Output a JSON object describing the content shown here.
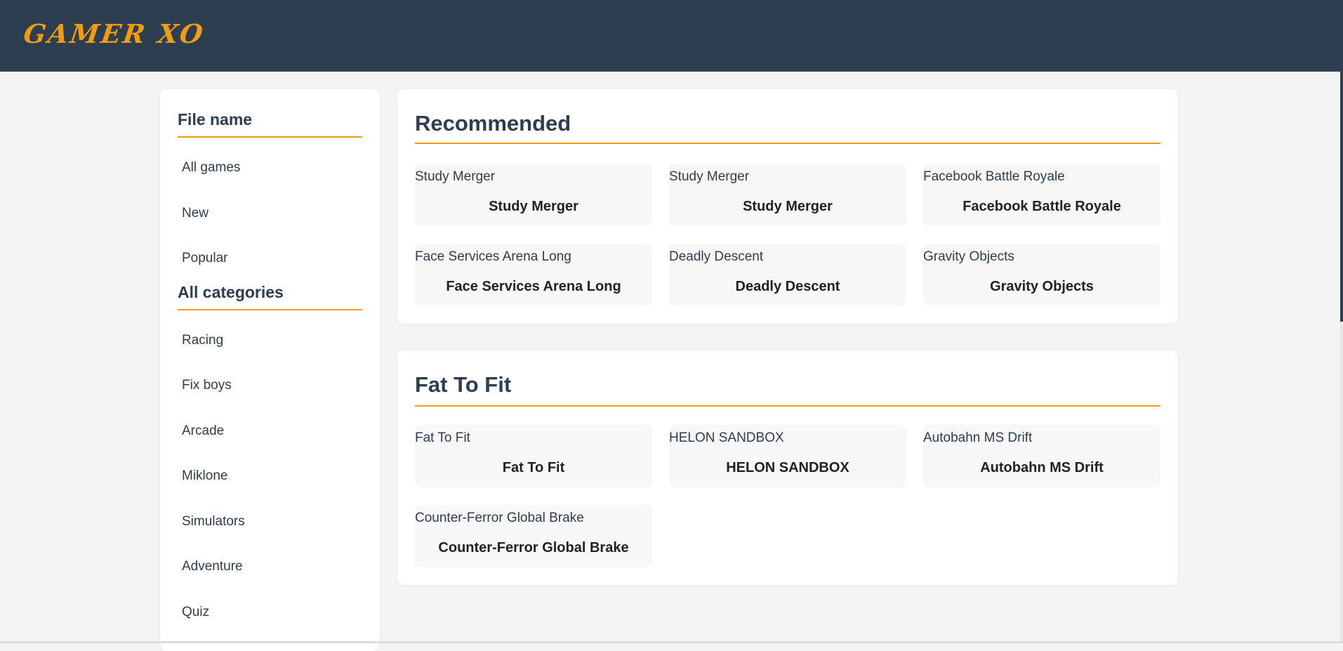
{
  "header": {
    "logo": "GAMER XO"
  },
  "sidebar": {
    "files": {
      "heading": "File name",
      "items": [
        {
          "label": "All games"
        },
        {
          "label": "New"
        },
        {
          "label": "Popular"
        }
      ]
    },
    "categories": {
      "heading": "All categories",
      "items": [
        {
          "label": "Racing"
        },
        {
          "label": "Fix boys"
        },
        {
          "label": "Arcade"
        },
        {
          "label": "Miklone"
        },
        {
          "label": "Simulators"
        },
        {
          "label": "Adventure"
        },
        {
          "label": "Quiz"
        }
      ]
    }
  },
  "recommended": {
    "title": "Recommended",
    "games": [
      {
        "label": "Study Merger",
        "title": "Study Merger"
      },
      {
        "label": "Study Merger",
        "title": "Study Merger"
      },
      {
        "label": "Facebook Battle Royale",
        "title": "Facebook Battle Royale"
      },
      {
        "label": "Face Services Arena Long",
        "title": "Face Services Arena Long"
      },
      {
        "label": "Deadly Descent",
        "title": "Deadly Descent"
      },
      {
        "label": "Gravity Objects",
        "title": "Gravity Objects"
      }
    ]
  },
  "fat_to_fit": {
    "title": "Fat To Fit",
    "games": [
      {
        "label": "Fat To Fit",
        "title": "Fat To Fit"
      },
      {
        "label": "HELON SANDBOX",
        "title": "HELON SANDBOX"
      },
      {
        "label": "Autobahn MS Drift",
        "title": "Autobahn MS Drift"
      },
      {
        "label": "Counter-Ferror Global Brake",
        "title": "Counter-Ferror Global Brake"
      }
    ]
  },
  "colors": {
    "header_bg": "#2c3e50",
    "accent": "#f39c12",
    "page_bg": "#f4f4f4",
    "card_bg": "#f7f7f7"
  }
}
